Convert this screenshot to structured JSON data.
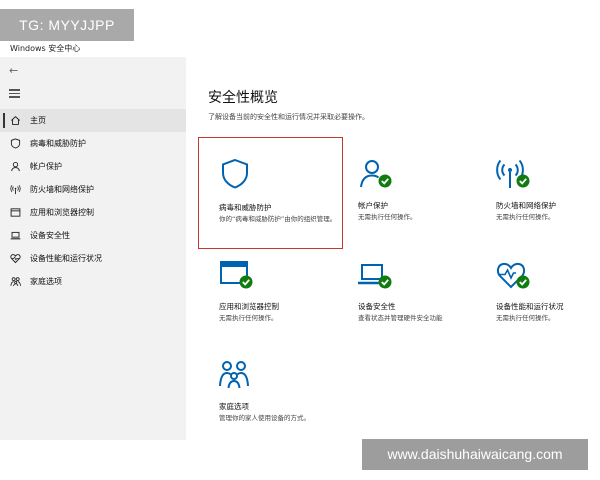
{
  "overlay": {
    "tg_badge": "TG: MYYJJPP",
    "watermark": "www.daishuhaiwaicang.com"
  },
  "window": {
    "title": "Windows 安全中心"
  },
  "sidebar": {
    "items": [
      {
        "label": "主页",
        "icon": "home-icon",
        "active": true
      },
      {
        "label": "病毒和威胁防护",
        "icon": "shield-icon"
      },
      {
        "label": "帐户保护",
        "icon": "person-icon"
      },
      {
        "label": "防火墙和网络保护",
        "icon": "wireless-icon"
      },
      {
        "label": "应用和浏览器控制",
        "icon": "browser-window-icon"
      },
      {
        "label": "设备安全性",
        "icon": "laptop-icon"
      },
      {
        "label": "设备性能和运行状况",
        "icon": "heart-pulse-icon"
      },
      {
        "label": "家庭选项",
        "icon": "family-icon"
      }
    ]
  },
  "main": {
    "title": "安全性概览",
    "subtitle": "了解设备当前的安全性和运行情况并采取必要操作。",
    "cards": [
      {
        "title": "病毒和威胁防护",
        "desc": "你的“病毒和威胁防护”由你的组织管理。",
        "icon": "shield-icon"
      },
      {
        "title": "帐户保护",
        "desc": "无需执行任何操作。",
        "icon": "person-check-icon"
      },
      {
        "title": "防火墙和网络保护",
        "desc": "无需执行任何操作。",
        "icon": "wireless-check-icon"
      },
      {
        "title": "应用和浏览器控制",
        "desc": "无需执行任何操作。",
        "icon": "browser-window-check-icon"
      },
      {
        "title": "设备安全性",
        "desc": "查看状态并管理硬件安全功能",
        "icon": "laptop-check-icon"
      },
      {
        "title": "设备性能和运行状况",
        "desc": "无需执行任何操作。",
        "icon": "heart-pulse-check-icon"
      },
      {
        "title": "家庭选项",
        "desc": "管理你的家人使用设备的方式。",
        "icon": "family-icon"
      }
    ]
  },
  "colors": {
    "accent": "#0063b1",
    "check": "#107c10",
    "highlight": "#c8372d"
  }
}
